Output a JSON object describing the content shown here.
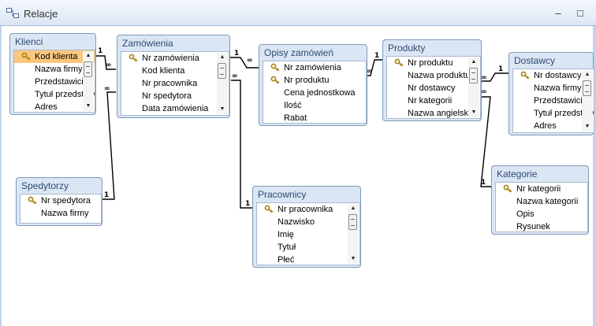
{
  "window": {
    "title": "Relacje",
    "minimize_glyph": "–",
    "restore_glyph": "□"
  },
  "cardinality": {
    "one": "1",
    "many": "∞"
  },
  "tables": {
    "klienci": {
      "title": "Klienci",
      "fields": [
        "Kod klienta",
        "Nazwa firmy",
        "Przedstawiciel",
        "Tytuł przedstawiciela",
        "Adres"
      ]
    },
    "zamowienia": {
      "title": "Zamówienia",
      "fields": [
        "Nr zamówienia",
        "Kod klienta",
        "Nr pracownika",
        "Nr spedytora",
        "Data zamówienia"
      ]
    },
    "opisy_zamowien": {
      "title": "Opisy zamówień",
      "fields": [
        "Nr zamówienia",
        "Nr produktu",
        "Cena jednostkowa",
        "Ilość",
        "Rabat"
      ]
    },
    "produkty": {
      "title": "Produkty",
      "fields": [
        "Nr produktu",
        "Nazwa produktu",
        "Nr dostawcy",
        "Nr kategorii",
        "Nazwa angielska"
      ]
    },
    "dostawcy": {
      "title": "Dostawcy",
      "fields": [
        "Nr dostawcy",
        "Nazwa firmy",
        "Przedstawiciel",
        "Tytuł przedstawiciela",
        "Adres"
      ]
    },
    "spedytorzy": {
      "title": "Spedytorzy",
      "fields": [
        "Nr spedytora",
        "Nazwa firmy"
      ]
    },
    "pracownicy": {
      "title": "Pracownicy",
      "fields": [
        "Nr pracownika",
        "Nazwisko",
        "Imię",
        "Tytuł",
        "Płeć"
      ]
    },
    "kategorie": {
      "title": "Kategorie",
      "fields": [
        "Nr kategorii",
        "Nazwa kategorii",
        "Opis",
        "Rysunek"
      ]
    }
  },
  "colors": {
    "selected_field": "#fbc77f",
    "table_header": "#dbe6f5",
    "table_title_text": "#2e4b6f",
    "relation_line": "#000000"
  }
}
